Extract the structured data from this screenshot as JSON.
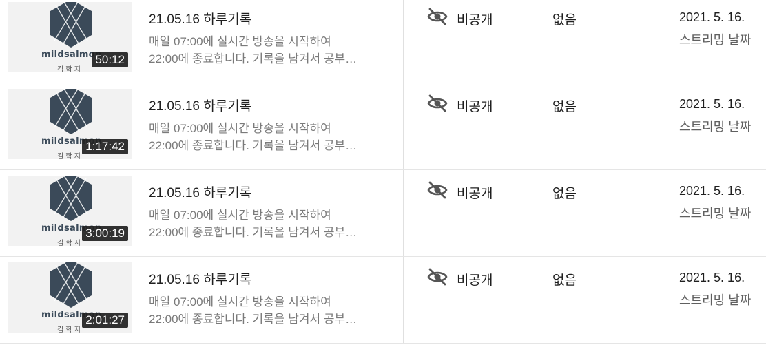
{
  "rows": [
    {
      "thumbnail": {
        "brand": "mildsalmon",
        "brand_sub": "김 학 지",
        "duration": "50:12"
      },
      "title": "21.05.16 하루기록",
      "description_line1": "매일 07:00에 실시간 방송을 시작하여",
      "description_line2": "22:00에 종료합니다. 기록을 남겨서 공부…",
      "visibility_icon": "eye-off-icon",
      "visibility": "비공개",
      "restrictions": "없음",
      "date": "2021. 5. 16.",
      "date_type": "스트리밍 날짜"
    },
    {
      "thumbnail": {
        "brand": "mildsalmon",
        "brand_sub": "김 학 지",
        "duration": "1:17:42"
      },
      "title": "21.05.16 하루기록",
      "description_line1": "매일 07:00에 실시간 방송을 시작하여",
      "description_line2": "22:00에 종료합니다. 기록을 남겨서 공부…",
      "visibility_icon": "eye-off-icon",
      "visibility": "비공개",
      "restrictions": "없음",
      "date": "2021. 5. 16.",
      "date_type": "스트리밍 날짜"
    },
    {
      "thumbnail": {
        "brand": "mildsalmon",
        "brand_sub": "김 학 지",
        "duration": "3:00:19"
      },
      "title": "21.05.16 하루기록",
      "description_line1": "매일 07:00에 실시간 방송을 시작하여",
      "description_line2": "22:00에 종료합니다. 기록을 남겨서 공부…",
      "visibility_icon": "eye-off-icon",
      "visibility": "비공개",
      "restrictions": "없음",
      "date": "2021. 5. 16.",
      "date_type": "스트리밍 날짜"
    },
    {
      "thumbnail": {
        "brand": "mildsalmon",
        "brand_sub": "김 학 지",
        "duration": "2:01:27"
      },
      "title": "21.05.16 하루기록",
      "description_line1": "매일 07:00에 실시간 방송을 시작하여",
      "description_line2": "22:00에 종료합니다. 기록을 남겨서 공부…",
      "visibility_icon": "eye-off-icon",
      "visibility": "비공개",
      "restrictions": "없음",
      "date": "2021. 5. 16.",
      "date_type": "스트리밍 날짜"
    }
  ],
  "colors": {
    "logo_hex": "#3b4a59",
    "duration_bg": "#212121",
    "divider": "#e5e5e5"
  }
}
